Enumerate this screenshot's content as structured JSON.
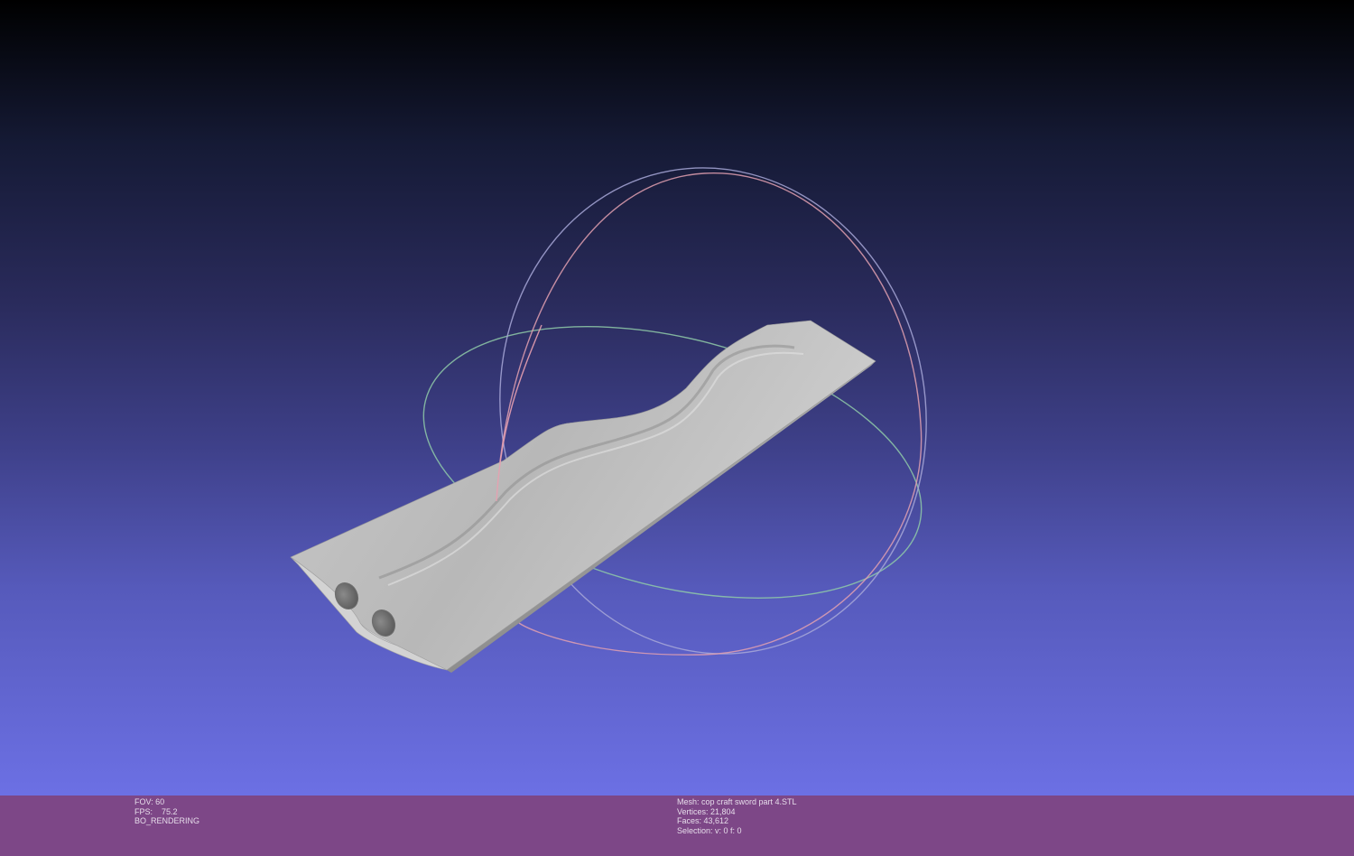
{
  "viewport": {
    "background_top": "#000000",
    "background_bottom": "#6c70e4"
  },
  "trackball": {
    "ring_colors": [
      "#e8a0b0",
      "#9ee0b8",
      "#b8b8f0"
    ]
  },
  "status_bar": {
    "background": "#7d4787",
    "fov": "FOV: 60",
    "fps": "FPS:    75.2",
    "render_mode": "BO_RENDERING",
    "mesh": "Mesh: cop craft sword part 4.STL",
    "vertices": "Vertices: 21,804",
    "faces": "Faces: 43,612",
    "selection": "Selection: v: 0 f: 0"
  }
}
